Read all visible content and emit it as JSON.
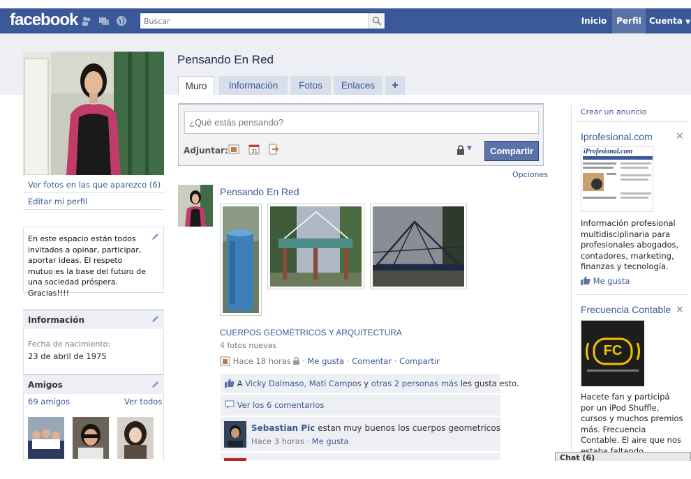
{
  "topbar": {
    "logo": "facebook",
    "search_placeholder": "Buscar",
    "nav": {
      "home": "Inicio",
      "profile": "Perfil",
      "account": "Cuenta"
    }
  },
  "profile": {
    "name": "Pensando En Red",
    "links": {
      "photos_of": "Ver fotos en las que aparezco (6)",
      "edit": "Editar mi perfil"
    },
    "bio": "En este espacio están todos invitados a opinar, participar, aportar ideas. El respeto mutuo es la base del futuro de una sociedad próspera. Gracias!!!!",
    "info": {
      "heading": "Información",
      "birth_label": "Fecha de nacimiento:",
      "birth_value": "23 de abril de 1975"
    },
    "friends": {
      "heading": "Amigos",
      "count": "69 amigos",
      "see_all": "Ver todos"
    }
  },
  "tabs": [
    "Muro",
    "Información",
    "Fotos",
    "Enlaces",
    "+"
  ],
  "composer": {
    "placeholder": "¿Qué estás pensando?",
    "attach_label": "Adjuntar:",
    "share": "Compartir",
    "options": "Opciones"
  },
  "post": {
    "author": "Pensando En Red",
    "album_title": "CUERPOS GEOMÉTRICOS Y ARQUITECTURA",
    "album_sub": "4 fotos nuevas",
    "meta": {
      "time": "Hace 18 horas",
      "like": "Me gusta",
      "comment": "Comentar",
      "share": "Compartir"
    },
    "likes": {
      "prefix": "A ",
      "names": "Vicky Dalmaso, Mati Campos",
      "y": " y ",
      "others": "otras 2 personas más",
      "suffix": " les gusta esto."
    },
    "view_comments": "Ver los 6 comentarios",
    "comment": {
      "author": "Sebastian Pic",
      "text": "estan muy buenos los cuerpos geometricos",
      "time": "Hace 3 horas",
      "like": "Me gusta"
    }
  },
  "ads": {
    "create": "Crear un anuncio",
    "ad1": {
      "title": "Iprofesional.com",
      "logo": "iProfesional.com",
      "text": "Información profesional multidisciplinaria para profesionales abogados, contadores, marketing, finanzas y tecnología.",
      "like": "Me gusta"
    },
    "ad2": {
      "title": "Frecuencia Contable",
      "logo": "FC",
      "text": "Hacete fan y participá por un iPod Shuffle, cursos y muchos premios más. Frecuencia Contable. El aire que nos estaba faltando."
    }
  },
  "chat": {
    "label": "Chat (6)"
  },
  "close_glyph": "×"
}
